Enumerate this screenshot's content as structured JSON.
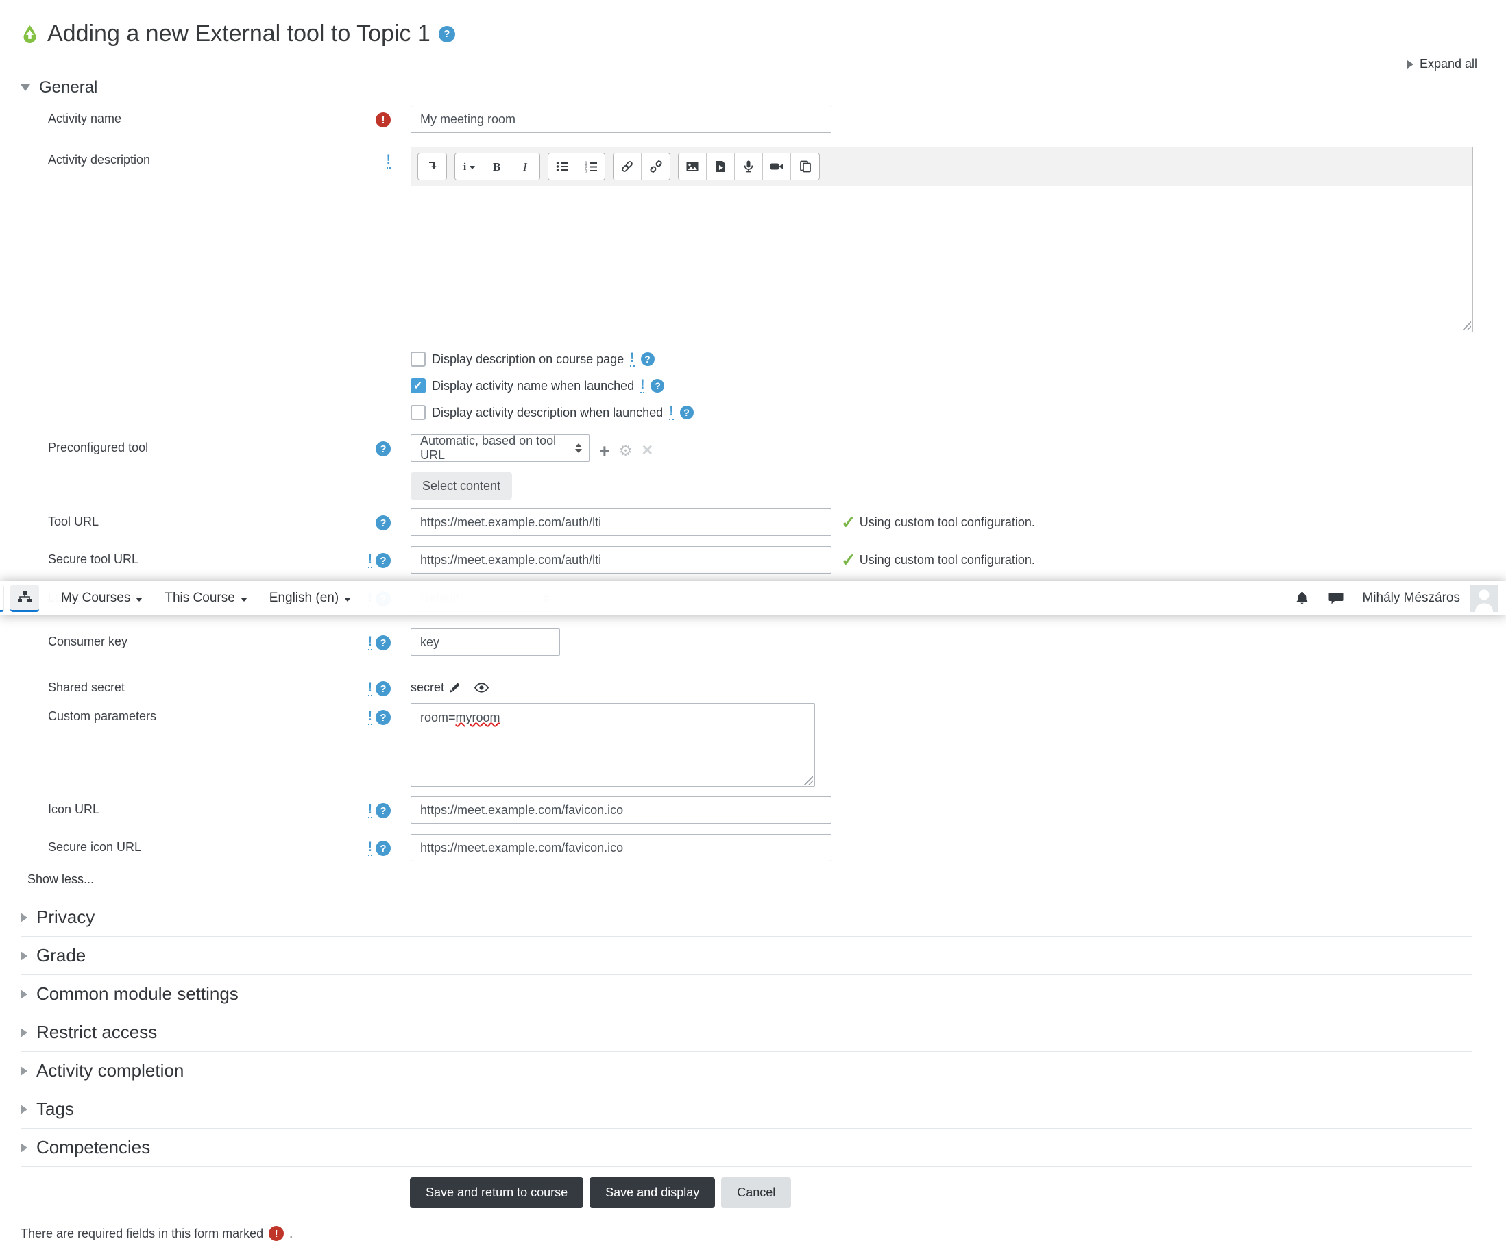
{
  "page": {
    "title": "Adding a new External tool to Topic 1",
    "expand_all": "Expand all",
    "general_heading": "General",
    "show_less": "Show less...",
    "required_note": "There are required fields in this form marked",
    "required_note_suffix": "."
  },
  "colors": {
    "accent_blue": "#1177d1",
    "help_blue": "#459ad0",
    "required_red": "#bf352a",
    "success_green": "#7ab648",
    "button_dark": "#343a40"
  },
  "navbar": {
    "menus": [
      {
        "label": "My Courses"
      },
      {
        "label": "This Course"
      },
      {
        "label": "English (en)"
      }
    ],
    "user_name": "Mihály Mészáros"
  },
  "editor": {
    "toolbar_icons": [
      "show-more",
      "paragraph-styles",
      "bold",
      "italic",
      "unordered-list",
      "ordered-list",
      "link",
      "unlink",
      "image",
      "media",
      "record-audio",
      "record-video",
      "manage-files"
    ]
  },
  "fields": {
    "activity_name": {
      "label": "Activity name",
      "value": "My meeting room"
    },
    "activity_description": {
      "label": "Activity description"
    },
    "display_description": {
      "label": "Display description on course page",
      "checked": false
    },
    "display_name_launched": {
      "label": "Display activity name when launched",
      "checked": true
    },
    "display_description_launched": {
      "label": "Display activity description when launched",
      "checked": false
    },
    "preconfigured_tool": {
      "label": "Preconfigured tool",
      "value": "Automatic, based on tool URL"
    },
    "select_content": "Select content",
    "tool_url": {
      "label": "Tool URL",
      "value": "https://meet.example.com/auth/lti",
      "status": "Using custom tool configuration."
    },
    "secure_tool_url": {
      "label": "Secure tool URL",
      "value": "https://meet.example.com/auth/lti",
      "status": "Using custom tool configuration."
    },
    "launch_container": {
      "label": "Launch container",
      "value": "Default"
    },
    "consumer_key": {
      "label": "Consumer key",
      "value": "key"
    },
    "shared_secret": {
      "label": "Shared secret",
      "value": "secret"
    },
    "custom_parameters": {
      "label": "Custom parameters",
      "value": "room=myroom",
      "value_prefix": "room=",
      "misspelled": "myroom"
    },
    "icon_url": {
      "label": "Icon URL",
      "value": "https://meet.example.com/favicon.ico"
    },
    "secure_icon_url": {
      "label": "Secure icon URL",
      "value": "https://meet.example.com/favicon.ico"
    }
  },
  "sections": [
    {
      "label": "Privacy"
    },
    {
      "label": "Grade"
    },
    {
      "label": "Common module settings"
    },
    {
      "label": "Restrict access"
    },
    {
      "label": "Activity completion"
    },
    {
      "label": "Tags"
    },
    {
      "label": "Competencies"
    }
  ],
  "actions": {
    "save_return": "Save and return to course",
    "save_display": "Save and display",
    "cancel": "Cancel"
  }
}
